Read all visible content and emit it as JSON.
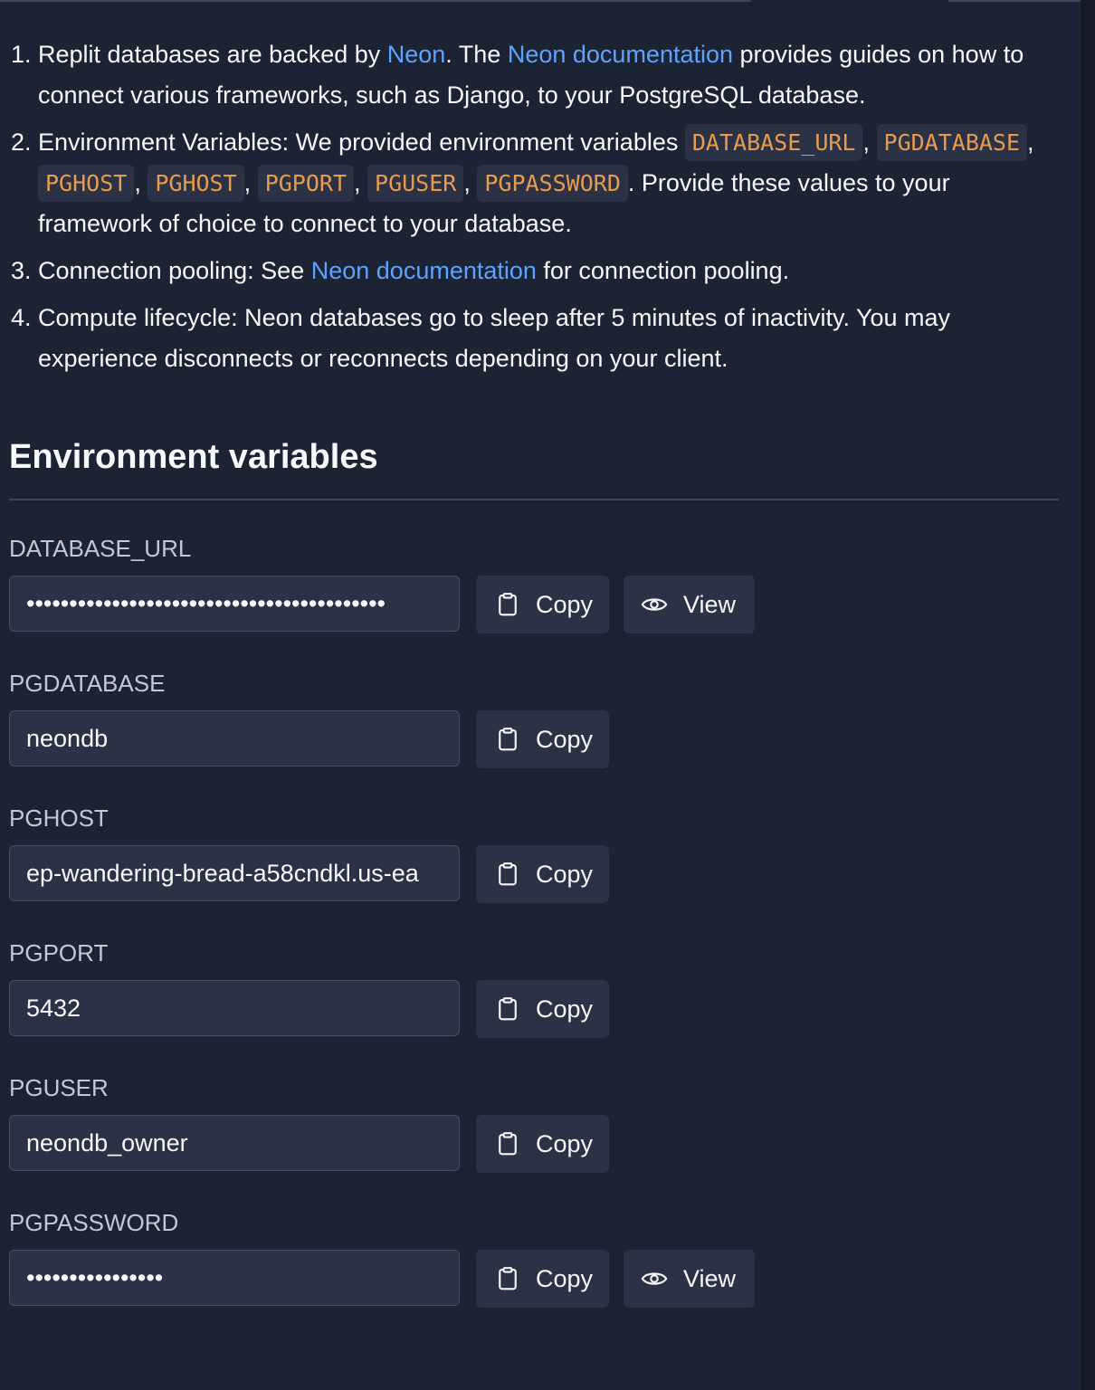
{
  "info": {
    "item1": {
      "t1": "Replit databases are backed by ",
      "link1": "Neon",
      "t2": ". The ",
      "link2": "Neon documentation",
      "t3": " provides guides on how to connect various frameworks, such as Django, to your PostgreSQL database."
    },
    "item2": {
      "t1": "Environment Variables: We provided environment variables ",
      "codes": [
        "DATABASE_URL",
        "PGDATABASE",
        "PGHOST",
        "PGHOST",
        "PGPORT",
        "PGUSER",
        "PGPASSWORD"
      ],
      "sep": ",",
      "t2": ". Provide these values to your framework of choice to connect to your database."
    },
    "item3": {
      "t1": "Connection pooling: See ",
      "link1": "Neon documentation",
      "t2": " for connection pooling."
    },
    "item4": {
      "t1": "Compute lifecycle: Neon databases go to sleep after 5 minutes of inactivity. You may experience disconnects or reconnects depending on your client."
    }
  },
  "section_title": "Environment variables",
  "buttons": {
    "copy": "Copy",
    "view": "View"
  },
  "variables": [
    {
      "label": "DATABASE_URL",
      "value": "••••••••••••••••••••••••••••••••••••••••••",
      "has_view": true
    },
    {
      "label": "PGDATABASE",
      "value": "neondb",
      "has_view": false
    },
    {
      "label": "PGHOST",
      "value": "ep-wandering-bread-a58cndkl.us-ea",
      "has_view": false
    },
    {
      "label": "PGPORT",
      "value": "5432",
      "has_view": false
    },
    {
      "label": "PGUSER",
      "value": "neondb_owner",
      "has_view": false
    },
    {
      "label": "PGPASSWORD",
      "value": "••••••••••••••••",
      "has_view": true
    }
  ],
  "colors": {
    "background": "#1c2333",
    "link": "#5ea2ff",
    "code_text": "#e89b4d",
    "surface": "#2b3245"
  },
  "icons": {
    "copy": "clipboard-icon",
    "view": "eye-icon"
  }
}
